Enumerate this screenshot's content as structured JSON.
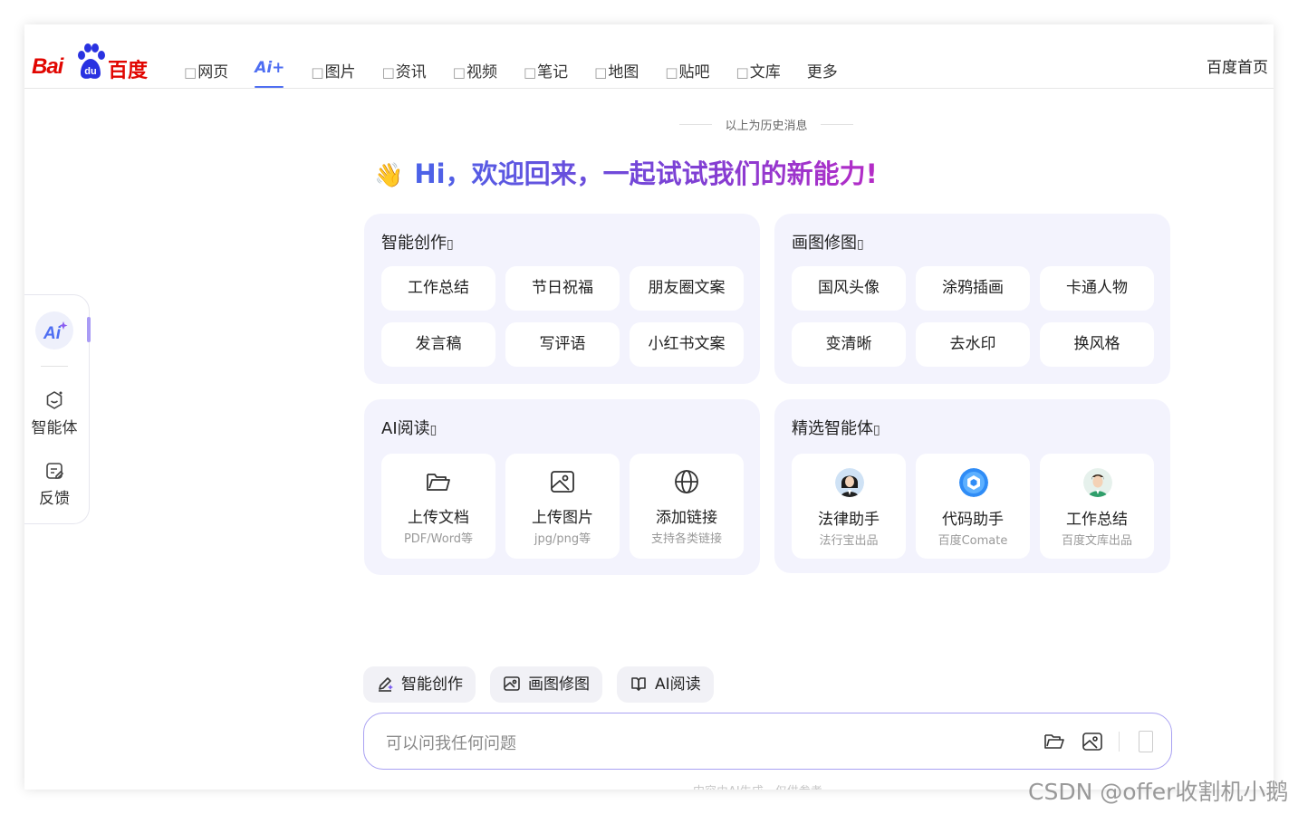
{
  "header": {
    "logo": {
      "left": "Bai",
      "paw_text": "du",
      "right": "百度"
    },
    "nav": [
      {
        "label": "网页",
        "icon": "□"
      },
      {
        "label": "Ai+",
        "icon": ""
      },
      {
        "label": "图片",
        "icon": "□"
      },
      {
        "label": "资讯",
        "icon": "□"
      },
      {
        "label": "视频",
        "icon": "□"
      },
      {
        "label": "笔记",
        "icon": "□"
      },
      {
        "label": "地图",
        "icon": "□"
      },
      {
        "label": "贴吧",
        "icon": "□"
      },
      {
        "label": "文库",
        "icon": "□"
      },
      {
        "label": "更多",
        "icon": ""
      }
    ],
    "home_link": "百度首页"
  },
  "sidebar": {
    "items": [
      {
        "label": "智能体",
        "icon": "agent-icon"
      },
      {
        "label": "反馈",
        "icon": "feedback-icon"
      }
    ]
  },
  "main": {
    "history_label": "以上为历史消息",
    "greeting": "Hi，欢迎回来，一起试试我们的新能力!",
    "cards": {
      "creation": {
        "title": "智能创作",
        "chips": [
          "工作总结",
          "节日祝福",
          "朋友圈文案",
          "发言稿",
          "写评语",
          "小红书文案"
        ]
      },
      "drawing": {
        "title": "画图修图",
        "chips": [
          "国风头像",
          "涂鸦插画",
          "卡通人物",
          "变清晰",
          "去水印",
          "换风格"
        ]
      },
      "reading": {
        "title": "AI阅读",
        "tiles": [
          {
            "title": "上传文档",
            "sub": "PDF/Word等",
            "icon": "folder-icon"
          },
          {
            "title": "上传图片",
            "sub": "jpg/png等",
            "icon": "image-icon"
          },
          {
            "title": "添加链接",
            "sub": "支持各类链接",
            "icon": "globe-icon"
          }
        ]
      },
      "agents": {
        "title": "精选智能体",
        "tiles": [
          {
            "title": "法律助手",
            "sub": "法行宝出品"
          },
          {
            "title": "代码助手",
            "sub": "百度Comate"
          },
          {
            "title": "工作总结",
            "sub": "百度文库出品"
          }
        ]
      }
    },
    "shortcuts": [
      "智能创作",
      "画图修图",
      "AI阅读"
    ],
    "input": {
      "placeholder": "可以问我任何问题"
    },
    "disclaimer": "内容由AI生成，仅供参考"
  },
  "watermark": "CSDN @offer收割机小鹅",
  "colors": {
    "brand_red": "#e10601",
    "brand_blue": "#4e6ef2",
    "accent_purple": "#a99bf5",
    "card_bg": "#f3f3fd"
  }
}
